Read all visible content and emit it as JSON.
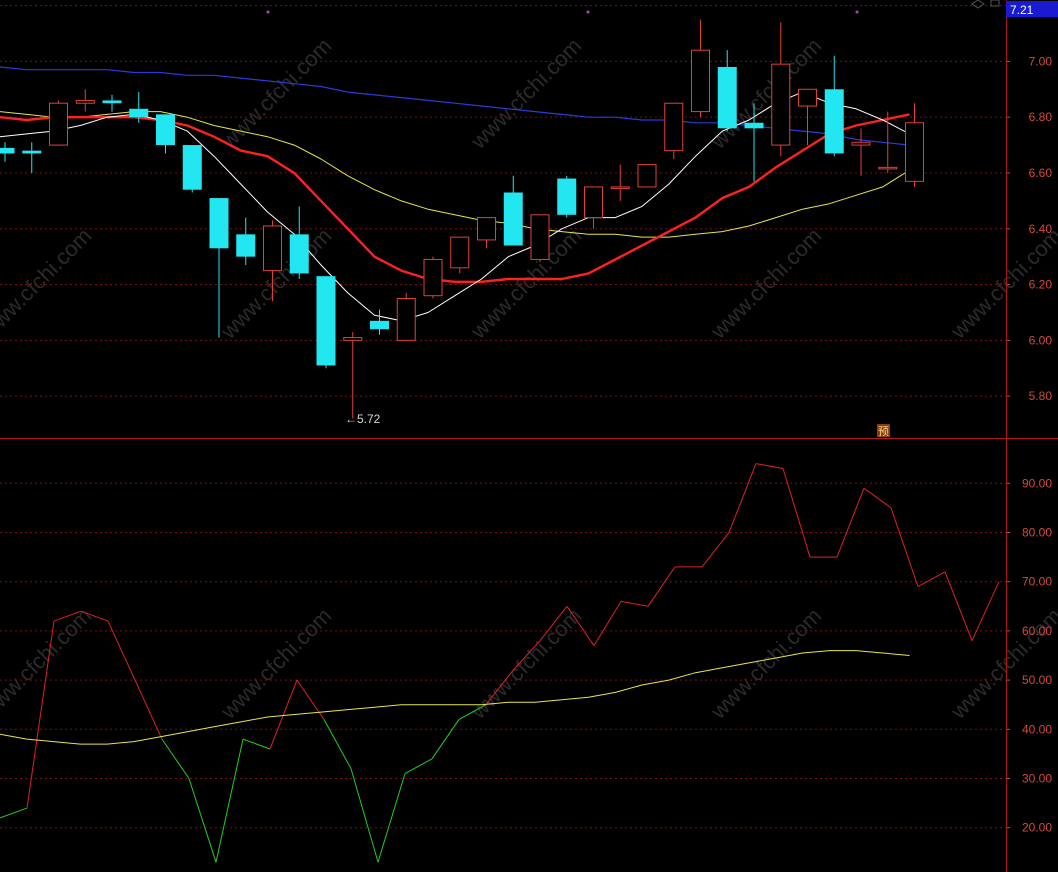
{
  "colors": {
    "up": "#e0403a",
    "down": "#22e6f0",
    "ma_white": "#ffffff",
    "ma_red": "#ff2020",
    "ma_yellow": "#e6e64a",
    "ma_blue": "#2b3bd8",
    "grid": "#7a1010",
    "axis_text": "#d24a3a",
    "rsi_red": "#e02020",
    "rsi_green": "#20d020",
    "rsi_signal": "#e6e64a",
    "price_tag_bg": "#1a1ad0"
  },
  "price_tag": "7.21",
  "low_annotation": "←5.72",
  "badge_label": "预",
  "watermark": "www.cfchi.com",
  "chart_data": [
    {
      "type": "candlestick",
      "ylim": [
        5.65,
        7.22
      ],
      "yticks": [
        {
          "v": 7.2,
          "label": "7.20"
        },
        {
          "v": 7.0,
          "label": "7.00"
        },
        {
          "v": 6.8,
          "label": "6.80"
        },
        {
          "v": 6.6,
          "label": "6.60"
        },
        {
          "v": 6.4,
          "label": "6.40"
        },
        {
          "v": 6.2,
          "label": "6.20"
        },
        {
          "v": 6.0,
          "label": "6.00"
        },
        {
          "v": 5.8,
          "label": "5.80"
        }
      ],
      "candles": [
        {
          "o": 6.69,
          "h": 6.71,
          "l": 6.64,
          "c": 6.67
        },
        {
          "o": 6.68,
          "h": 6.71,
          "l": 6.6,
          "c": 6.67
        },
        {
          "o": 6.7,
          "h": 6.86,
          "l": 6.7,
          "c": 6.85
        },
        {
          "o": 6.85,
          "h": 6.9,
          "l": 6.82,
          "c": 6.86
        },
        {
          "o": 6.86,
          "h": 6.88,
          "l": 6.82,
          "c": 6.85
        },
        {
          "o": 6.83,
          "h": 6.89,
          "l": 6.78,
          "c": 6.8
        },
        {
          "o": 6.81,
          "h": 6.81,
          "l": 6.67,
          "c": 6.7
        },
        {
          "o": 6.7,
          "h": 6.7,
          "l": 6.53,
          "c": 6.54
        },
        {
          "o": 6.51,
          "h": 6.51,
          "l": 6.01,
          "c": 6.33
        },
        {
          "o": 6.38,
          "h": 6.44,
          "l": 6.27,
          "c": 6.3
        },
        {
          "o": 6.25,
          "h": 6.43,
          "l": 6.14,
          "c": 6.41
        },
        {
          "o": 6.38,
          "h": 6.48,
          "l": 6.22,
          "c": 6.24
        },
        {
          "o": 6.23,
          "h": 6.23,
          "l": 5.9,
          "c": 5.91
        },
        {
          "o": 6.0,
          "h": 6.03,
          "l": 5.72,
          "c": 6.01
        },
        {
          "o": 6.07,
          "h": 6.11,
          "l": 6.02,
          "c": 6.04
        },
        {
          "o": 6.0,
          "h": 6.17,
          "l": 6.0,
          "c": 6.15
        },
        {
          "o": 6.16,
          "h": 6.3,
          "l": 6.15,
          "c": 6.29
        },
        {
          "o": 6.26,
          "h": 6.37,
          "l": 6.24,
          "c": 6.37
        },
        {
          "o": 6.36,
          "h": 6.44,
          "l": 6.33,
          "c": 6.44
        },
        {
          "o": 6.53,
          "h": 6.59,
          "l": 6.34,
          "c": 6.34
        },
        {
          "o": 6.29,
          "h": 6.45,
          "l": 6.28,
          "c": 6.45
        },
        {
          "o": 6.58,
          "h": 6.59,
          "l": 6.44,
          "c": 6.45
        },
        {
          "o": 6.44,
          "h": 6.55,
          "l": 6.4,
          "c": 6.55
        },
        {
          "o": 6.55,
          "h": 6.63,
          "l": 6.5,
          "c": 6.55
        },
        {
          "o": 6.55,
          "h": 6.63,
          "l": 6.55,
          "c": 6.63
        },
        {
          "o": 6.68,
          "h": 6.85,
          "l": 6.65,
          "c": 6.85
        },
        {
          "o": 6.82,
          "h": 7.15,
          "l": 6.8,
          "c": 7.04
        },
        {
          "o": 6.98,
          "h": 7.04,
          "l": 6.75,
          "c": 6.76
        },
        {
          "o": 6.78,
          "h": 6.85,
          "l": 6.57,
          "c": 6.76
        },
        {
          "o": 6.7,
          "h": 7.14,
          "l": 6.66,
          "c": 6.99
        },
        {
          "o": 6.84,
          "h": 6.9,
          "l": 6.7,
          "c": 6.9
        },
        {
          "o": 6.9,
          "h": 7.02,
          "l": 6.66,
          "c": 6.67
        },
        {
          "o": 6.7,
          "h": 6.76,
          "l": 6.59,
          "c": 6.71
        },
        {
          "o": 6.62,
          "h": 6.82,
          "l": 6.6,
          "c": 6.62
        },
        {
          "o": 6.57,
          "h": 6.85,
          "l": 6.55,
          "c": 6.78
        }
      ],
      "ma_white": [
        6.73,
        6.74,
        6.75,
        6.77,
        6.8,
        6.81,
        6.79,
        6.75,
        6.66,
        6.56,
        6.46,
        6.38,
        6.27,
        6.17,
        6.09,
        6.07,
        6.1,
        6.16,
        6.22,
        6.3,
        6.34,
        6.4,
        6.44,
        6.44,
        6.48,
        6.56,
        6.66,
        6.75,
        6.79,
        6.85,
        6.89,
        6.85,
        6.83,
        6.79,
        6.74
      ],
      "ma_red": [
        6.8,
        6.79,
        6.8,
        6.8,
        6.8,
        6.8,
        6.79,
        6.77,
        6.73,
        6.68,
        6.66,
        6.6,
        6.5,
        6.4,
        6.3,
        6.25,
        6.22,
        6.21,
        6.21,
        6.22,
        6.22,
        6.22,
        6.24,
        6.29,
        6.34,
        6.39,
        6.44,
        6.51,
        6.55,
        6.62,
        6.68,
        6.74,
        6.77,
        6.79,
        6.81
      ],
      "ma_yellow": [
        6.82,
        6.81,
        6.8,
        6.8,
        6.81,
        6.82,
        6.82,
        6.8,
        6.77,
        6.75,
        6.73,
        6.7,
        6.65,
        6.59,
        6.54,
        6.5,
        6.47,
        6.45,
        6.43,
        6.42,
        6.4,
        6.39,
        6.38,
        6.38,
        6.37,
        6.37,
        6.38,
        6.39,
        6.41,
        6.44,
        6.47,
        6.49,
        6.52,
        6.55,
        6.61
      ],
      "ma_blue": [
        6.98,
        6.97,
        6.97,
        6.97,
        6.97,
        6.96,
        6.96,
        6.95,
        6.95,
        6.94,
        6.93,
        6.92,
        6.91,
        6.89,
        6.88,
        6.87,
        6.86,
        6.85,
        6.84,
        6.83,
        6.82,
        6.81,
        6.8,
        6.8,
        6.79,
        6.79,
        6.78,
        6.78,
        6.77,
        6.76,
        6.75,
        6.74,
        6.72,
        6.71,
        6.7
      ]
    },
    {
      "type": "line",
      "ylim": [
        11,
        99
      ],
      "yticks": [
        {
          "v": 90,
          "label": "90.00"
        },
        {
          "v": 80,
          "label": "80.00"
        },
        {
          "v": 70,
          "label": "70.00"
        },
        {
          "v": 60,
          "label": "60.00"
        },
        {
          "v": 50,
          "label": "50.00"
        },
        {
          "v": 40,
          "label": "40.00"
        },
        {
          "v": 30,
          "label": "30.00"
        },
        {
          "v": 20,
          "label": "20.00"
        }
      ],
      "rsi": [
        22,
        24,
        62,
        64,
        62,
        50,
        38,
        30,
        13,
        38,
        36,
        50,
        42,
        32,
        13,
        31,
        34,
        42,
        45,
        52,
        58,
        65,
        57,
        66,
        65,
        73,
        73,
        80,
        94,
        93,
        75,
        75,
        89,
        85,
        69,
        72,
        58,
        70
      ],
      "signal": [
        39,
        38,
        37.5,
        37,
        37,
        37.5,
        38.5,
        39.5,
        40.5,
        41.5,
        42.5,
        43,
        43.5,
        44,
        44.5,
        45,
        45,
        45,
        45,
        45.5,
        45.5,
        46,
        46.5,
        47.5,
        49,
        50,
        51.5,
        52.5,
        53.5,
        54.5,
        55.5,
        56,
        56,
        55.5,
        55
      ]
    }
  ]
}
